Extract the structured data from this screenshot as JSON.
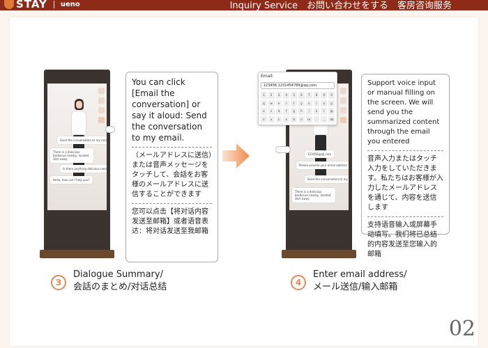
{
  "header": {
    "brand": "STAY",
    "brand_sub": "ueno",
    "title": "Inquiry Service　お問い合わせをする　客房咨询服务"
  },
  "kiosk3": {
    "messages": [
      "Send the conversation to my email",
      "There is a delicious barbecue nearby, located 3km away",
      "Is there anything delicious nearby?",
      "Hello, how can I help you?"
    ]
  },
  "callout3": {
    "en": "You can click [Email the conversation] or say it aloud: Send the conversation to my email.",
    "jp": "（メールアドレスに送信）または音声メッセージをタッチして、会話をお客様のメールアドレスに送信することができます",
    "cn": "您可以点击【将对话内容发送至邮箱】或者语音表达：将对话发送至我邮箱"
  },
  "kiosk4": {
    "email_label": "Email:",
    "email_value": "123456 1231454789@qq.com",
    "messages": [
      "123456@qq.com",
      "Please provide your email address",
      "Send the conversation to my email",
      "There is a delicious barbecue nearby, located 3km away"
    ],
    "keys": [
      "1",
      "2",
      "3",
      "4",
      "5",
      "6",
      "7",
      "8",
      "9",
      "0",
      "q",
      "w",
      "e",
      "r",
      "t",
      "y",
      "u",
      "i",
      "o",
      "p",
      "a",
      "s",
      "d",
      "f",
      "g",
      "h",
      "j",
      "k",
      "l",
      "@",
      "z",
      "x",
      "c",
      "v",
      "b",
      "n",
      "m",
      ".",
      "_",
      "⌫"
    ]
  },
  "callout4": {
    "en": "Support voice input or manual filling on the screen. We will send you the summarized content through the email you entered",
    "jp": "音声入力またはタッチ入力をしていただきます。私たちはお客様が入力したメールアドレスを通じて、内容を送信します",
    "cn": "支持语音输入或屏幕手动填写。我们将已总结的内容发送至您输入的邮箱"
  },
  "step3": {
    "num": "3",
    "line1": "Dialogue Summary/",
    "line2": "会話のまとめ/对话总结"
  },
  "step4": {
    "num": "4",
    "line1": "Enter email address/",
    "line2": "メール送信/输入邮箱"
  },
  "page_number": "02",
  "colors": {
    "header_bg": "#8e2a17",
    "accent": "#e38b56"
  }
}
